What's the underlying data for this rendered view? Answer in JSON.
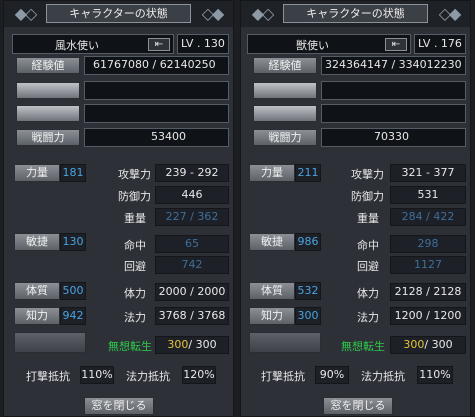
{
  "common": {
    "title": "キャラクターの状態",
    "close_label": "窓を閉じる",
    "labels": {
      "exp": "経験値",
      "combat": "戦闘力",
      "str": "力量",
      "dex": "敏捷",
      "con": "体質",
      "int": "知力",
      "attack": "攻撃力",
      "defense": "防御力",
      "weight": "重量",
      "hit": "命中",
      "evade": "回避",
      "hp": "体力",
      "mp": "法力",
      "special": "無想転生",
      "hit_resist": "打撃抵抗",
      "magic_resist": "法力抵抗"
    }
  },
  "left": {
    "name": "風水使い",
    "level": "LV . 130",
    "exp": "61767080 / 62140250",
    "combat": "53400",
    "str": "181",
    "dex": "130",
    "con": "500",
    "int": "942",
    "attack": "239 - 292",
    "defense": "446",
    "weight": "227 / 362",
    "hit": "65",
    "evade": "742",
    "hp": "2000 / 2000",
    "mp": "3768 / 3768",
    "special_cur": "300",
    "special_max": "/ 300",
    "hit_resist": "110%",
    "magic_resist": "120%"
  },
  "right": {
    "name": "獣使い",
    "level": "LV . 176",
    "exp": "324364147 / 334012230",
    "combat": "70330",
    "str": "211",
    "dex": "986",
    "con": "532",
    "int": "300",
    "attack": "321 - 377",
    "defense": "531",
    "weight": "284 / 422",
    "hit": "298",
    "evade": "1127",
    "hp": "2128 / 2128",
    "mp": "1200 / 1200",
    "special_cur": "300",
    "special_max": "/ 300",
    "hit_resist": "90%",
    "magic_resist": "110%"
  }
}
